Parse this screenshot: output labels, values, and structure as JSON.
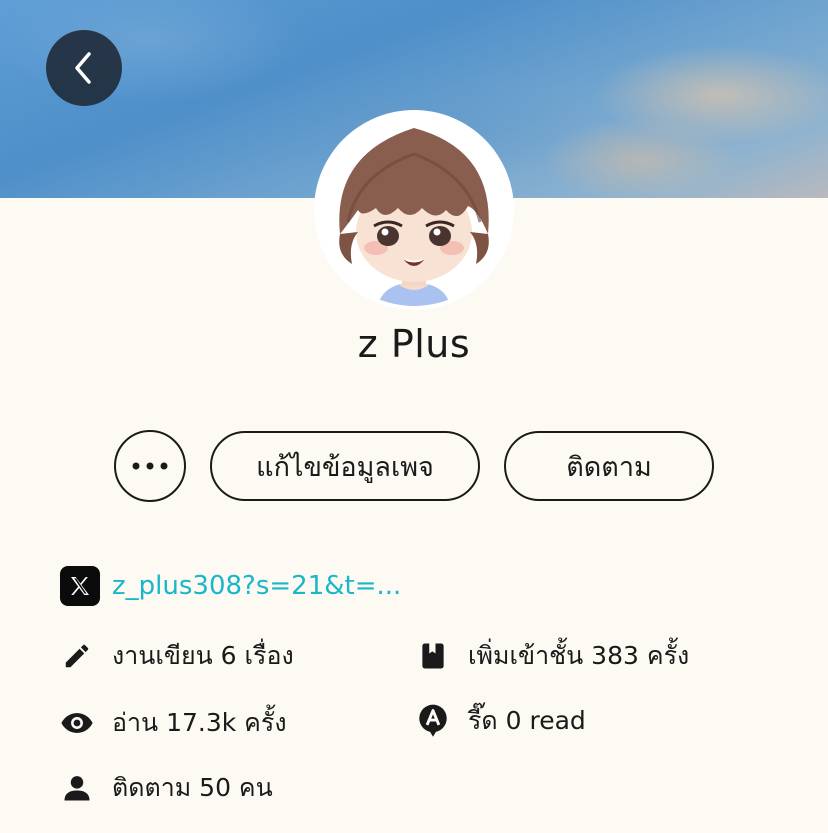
{
  "profile": {
    "name": "z Plus"
  },
  "actions": {
    "more_label": "•••",
    "edit_label": "แก้ไขข้อมูลเพจ",
    "follow_label": "ติดตาม"
  },
  "social": {
    "x_handle": "z_plus308?s=21&t=..."
  },
  "stats": {
    "works": "งานเขียน 6 เรื่อง",
    "shelf_adds": "เพิ่มเข้าชั้น 383 ครั้ง",
    "reads": "อ่าน 17.3k ครั้ง",
    "read_count": "รี๊ด 0 read",
    "followers": "ติดตาม 50 คน"
  },
  "icons": {
    "back": "chevron-left-icon",
    "more": "more-dots-icon",
    "x": "x-logo-icon",
    "works": "pencil-icon",
    "shelf": "bookmark-book-icon",
    "reads": "eye-icon",
    "read_count": "speech-a-icon",
    "followers": "person-icon"
  },
  "colors": {
    "background": "#fdf9f3",
    "link": "#18b8c8",
    "text": "#1a1a1a"
  }
}
